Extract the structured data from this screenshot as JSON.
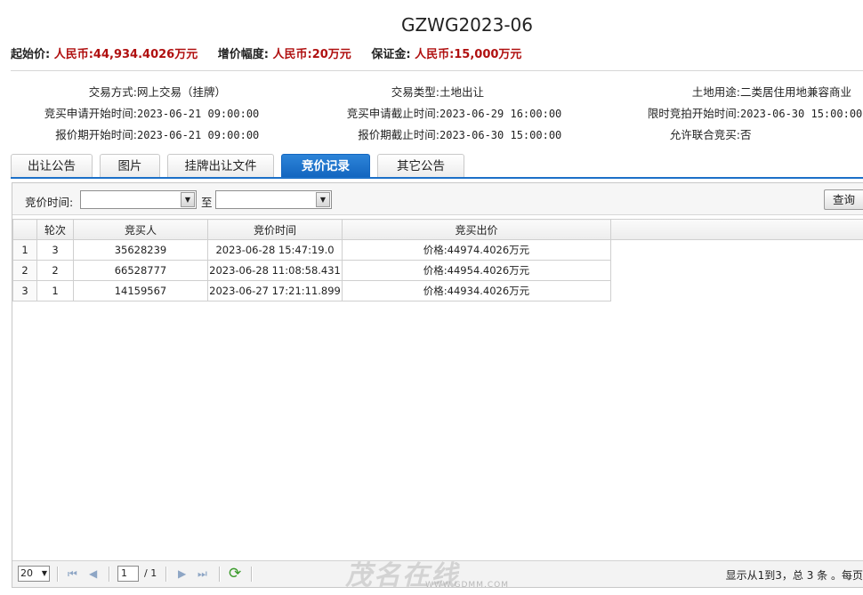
{
  "title": "GZWG2023-06",
  "price_line": {
    "start_label": "起始价:",
    "start_value": "人民币:44,934.4026万元",
    "increment_label": "增价幅度:",
    "increment_value": "人民币:20万元",
    "deposit_label": "保证金:",
    "deposit_value": "人民币:15,000万元"
  },
  "info": {
    "col1": [
      {
        "k": "交易方式:",
        "v": "网上交易（挂牌）"
      },
      {
        "k": "竞买申请开始时间:",
        "v": "2023-06-21 09:00:00"
      },
      {
        "k": "报价期开始时间:",
        "v": "2023-06-21 09:00:00"
      }
    ],
    "col2": [
      {
        "k": "交易类型:",
        "v": "土地出让"
      },
      {
        "k": "竞买申请截止时间:",
        "v": "2023-06-29 16:00:00"
      },
      {
        "k": "报价期截止时间:",
        "v": "2023-06-30 15:00:00"
      }
    ],
    "col3": [
      {
        "k": "土地用途:",
        "v": "二类居住用地兼容商业"
      },
      {
        "k": "限时竞拍开始时间:",
        "v": "2023-06-30 15:00:00"
      },
      {
        "k": "允许联合竞买:",
        "v": "否"
      }
    ]
  },
  "tabs": [
    {
      "label": "出让公告",
      "active": false
    },
    {
      "label": "图片",
      "active": false
    },
    {
      "label": "挂牌出让文件",
      "active": false
    },
    {
      "label": "竞价记录",
      "active": true
    },
    {
      "label": "其它公告",
      "active": false
    }
  ],
  "filter": {
    "label": "竞价时间:",
    "between": "至",
    "query_button": "查询"
  },
  "grid": {
    "columns": [
      "轮次",
      "竞买人",
      "竞价时间",
      "竞买出价"
    ],
    "rows": [
      {
        "n": "1",
        "round": "3",
        "bidder": "35628239",
        "time": "2023-06-28 15:47:19.0",
        "price": "价格:44974.4026万元"
      },
      {
        "n": "2",
        "round": "2",
        "bidder": "66528777",
        "time": "2023-06-28 11:08:58.431",
        "price": "价格:44954.4026万元"
      },
      {
        "n": "3",
        "round": "1",
        "bidder": "14159567",
        "time": "2023-06-27 17:21:11.899",
        "price": "价格:44934.4026万元"
      }
    ]
  },
  "pager": {
    "page_size": "20",
    "page": "1",
    "total_pages": "/ 1",
    "summary": "显示从1到3，总 3 条 。每页"
  },
  "watermark": {
    "text": "茂名在线",
    "url": "WWW.GDMM.COM"
  },
  "colors": {
    "accent": "#1c70c8",
    "price_red": "#b01010"
  }
}
